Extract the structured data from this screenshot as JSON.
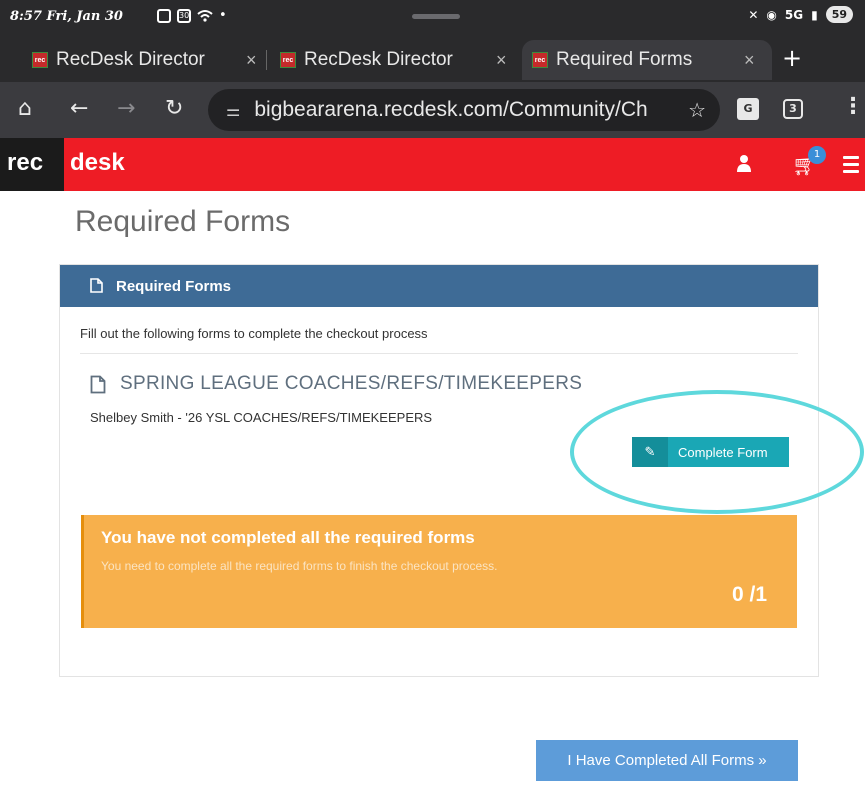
{
  "status_bar": {
    "time": "8:57",
    "date": "Fri, Jan 30",
    "calendar_day": "30",
    "network": "5G",
    "battery": "59"
  },
  "browser": {
    "tabs": [
      {
        "label": "RecDesk Director",
        "active": false
      },
      {
        "label": "RecDesk Director",
        "active": false
      },
      {
        "label": "Required Forms",
        "active": true
      }
    ],
    "favicon_text": "rec",
    "new_tab": "+",
    "url": "bigbeararena.recdesk.com/Community/Ch",
    "tab_count": "3"
  },
  "site": {
    "logo_left": "rec",
    "logo_right": "desk",
    "cart_count": "1",
    "colors": {
      "brand_red": "#ee1c25",
      "panel_blue": "#3e6b96",
      "teal": "#1aa7b5",
      "warning": "#f7b04c",
      "button_blue": "#5d9cd9"
    }
  },
  "page": {
    "title": "Required Forms",
    "panel_title": "Required Forms",
    "intro": "Fill out the following forms to complete the checkout process",
    "form": {
      "name": "SPRING LEAGUE COACHES/REFS/TIMEKEEPERS",
      "participant": "Shelbey Smith - '26 YSL COACHES/REFS/TIMEKEEPERS",
      "button_label": "Complete Form"
    },
    "warning": {
      "heading": "You have not completed all the required forms",
      "message": "You need to complete all the required forms to finish the checkout process.",
      "progress": "0 /1"
    },
    "submit_label": "I Have Completed All Forms »"
  }
}
